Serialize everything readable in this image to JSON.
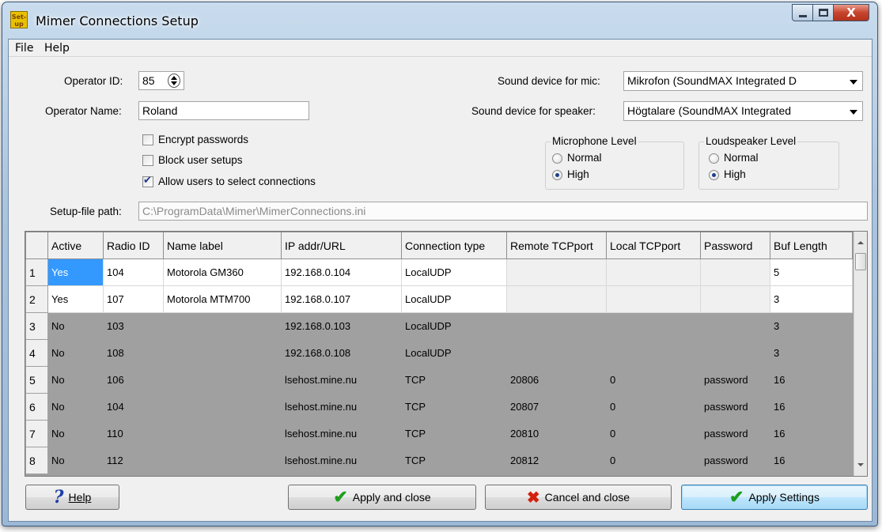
{
  "window": {
    "title": "Mimer Connections Setup",
    "app_icon_text": "Set-up"
  },
  "menu": [
    "File",
    "Help"
  ],
  "operator": {
    "id_label": "Operator ID:",
    "id_value": "85",
    "name_label": "Operator Name:",
    "name_value": "Roland"
  },
  "sound": {
    "mic_label": "Sound device for mic:",
    "mic_value": "Mikrofon (SoundMAX Integrated D",
    "speaker_label": "Sound device for speaker:",
    "speaker_value": "Högtalare (SoundMAX Integrated"
  },
  "options": [
    {
      "label": "Encrypt passwords",
      "checked": false
    },
    {
      "label": "Block user setups",
      "checked": false
    },
    {
      "label": "Allow users to select connections",
      "checked": true
    }
  ],
  "mic_level": {
    "title": "Microphone Level",
    "normal": "Normal",
    "high": "High",
    "selected": "High"
  },
  "speaker_level": {
    "title": "Loudspeaker Level",
    "normal": "Normal",
    "high": "High",
    "selected": "High"
  },
  "setup_file": {
    "label": "Setup-file path:",
    "value": "C:\\ProgramData\\Mimer\\MimerConnections.ini"
  },
  "grid": {
    "headers": [
      "",
      "Active",
      "Radio ID",
      "Name label",
      "IP addr/URL",
      "Connection type",
      "Remote TCPport",
      "Local TCPport",
      "Password",
      "Buf Length"
    ],
    "rows": [
      {
        "num": "1",
        "active": "Yes",
        "radio_id": "104",
        "name": "Motorola GM360",
        "ip": "192.168.0.104",
        "type": "LocalUDP",
        "remote": "",
        "local": "",
        "password": "",
        "buf": "5"
      },
      {
        "num": "2",
        "active": "Yes",
        "radio_id": "107",
        "name": "Motorola MTM700",
        "ip": "192.168.0.107",
        "type": "LocalUDP",
        "remote": "",
        "local": "",
        "password": "",
        "buf": "3"
      },
      {
        "num": "3",
        "active": "No",
        "radio_id": "103",
        "name": "",
        "ip": "192.168.0.103",
        "type": "LocalUDP",
        "remote": "",
        "local": "",
        "password": "",
        "buf": "3"
      },
      {
        "num": "4",
        "active": "No",
        "radio_id": "108",
        "name": "",
        "ip": "192.168.0.108",
        "type": "LocalUDP",
        "remote": "",
        "local": "",
        "password": "",
        "buf": "3"
      },
      {
        "num": "5",
        "active": "No",
        "radio_id": "106",
        "name": "",
        "ip": "lsehost.mine.nu",
        "type": "TCP",
        "remote": "20806",
        "local": "0",
        "password": "password",
        "buf": "16"
      },
      {
        "num": "6",
        "active": "No",
        "radio_id": "104",
        "name": "",
        "ip": "lsehost.mine.nu",
        "type": "TCP",
        "remote": "20807",
        "local": "0",
        "password": "password",
        "buf": "16"
      },
      {
        "num": "7",
        "active": "No",
        "radio_id": "110",
        "name": "",
        "ip": "lsehost.mine.nu",
        "type": "TCP",
        "remote": "20810",
        "local": "0",
        "password": "password",
        "buf": "16"
      },
      {
        "num": "8",
        "active": "No",
        "radio_id": "112",
        "name": "",
        "ip": "lsehost.mine.nu",
        "type": "TCP",
        "remote": "20812",
        "local": "0",
        "password": "password",
        "buf": "16"
      }
    ]
  },
  "buttons": {
    "help": "Help",
    "apply_close": "Apply and close",
    "cancel_close": "Cancel and close",
    "apply_settings": "Apply Settings"
  }
}
